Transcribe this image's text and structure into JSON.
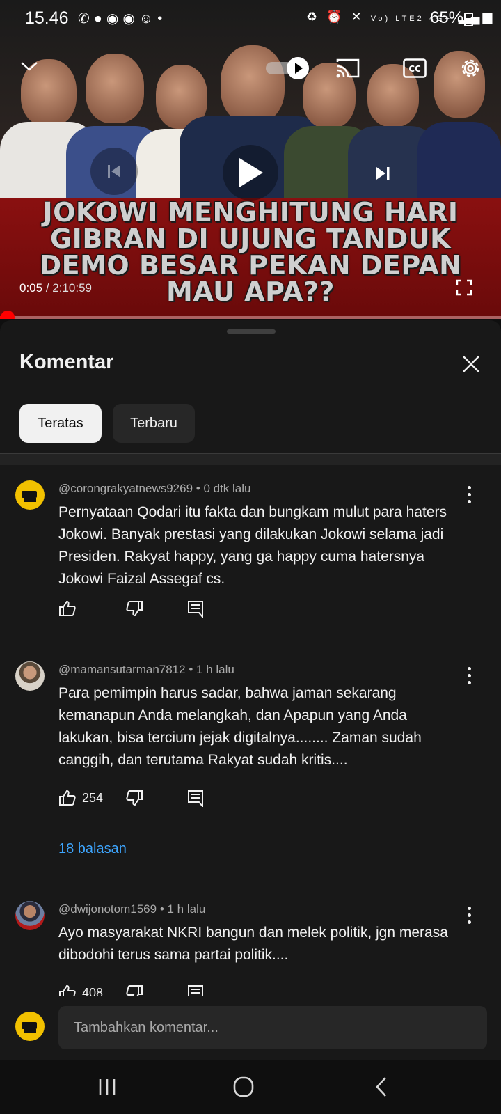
{
  "status_bar": {
    "time": "15.46",
    "left_icons": [
      "whatsapp-icon",
      "chat-icon",
      "record-icon",
      "record-icon",
      "baby-icon",
      "dot"
    ],
    "network": "Vo) LTE2 4G+",
    "battery": "65%"
  },
  "video": {
    "headline_lines": [
      "JOKOWI MENGHITUNG HARI",
      "GIBRAN DI UJUNG TANDUK",
      "DEMO BESAR PEKAN DEPAN",
      "MAU APA??"
    ],
    "current_time": "0:05",
    "duration": "/ 2:10:59",
    "progress_fraction": 0.0006,
    "autoplay_on": true
  },
  "comments_panel": {
    "title": "Komentar",
    "chips": [
      {
        "label": "Teratas",
        "active": true
      },
      {
        "label": "Terbaru",
        "active": false
      }
    ],
    "comments": [
      {
        "author": "@corongrakyatnews9269",
        "time": "• 0 dtk lalu",
        "text": "Pernyataan Qodari itu fakta dan bungkam mulut para haters Jokowi. Banyak prestasi yang dilakukan Jokowi selama jadi Presiden. Rakyat happy, yang ga happy cuma hatersnya Jokowi Faizal Assegaf cs.",
        "likes": "",
        "replies": ""
      },
      {
        "author": "@mamansutarman7812",
        "time": "• 1 h lalu",
        "text": "Para pemimpin harus sadar, bahwa jaman sekarang kemanapun Anda melangkah, dan Apapun yang Anda lakukan, bisa tercium jejak digitalnya........ Zaman sudah canggih, dan terutama Rakyat sudah kritis....",
        "likes": "254",
        "replies": "18 balasan"
      },
      {
        "author": "@dwijonotom1569",
        "time": "• 1 h lalu",
        "text": "Ayo masyarakat NKRI bangun dan melek politik, jgn merasa dibodohi terus sama partai politik....",
        "likes": "408",
        "replies": ""
      }
    ]
  },
  "composer": {
    "placeholder": "Tambahkan komentar..."
  },
  "colors": {
    "background": "#0f0f0f",
    "panel": "#181818",
    "chip_active": "#f1f1f1",
    "link": "#3ea6ff",
    "progress": "#ff0000"
  }
}
